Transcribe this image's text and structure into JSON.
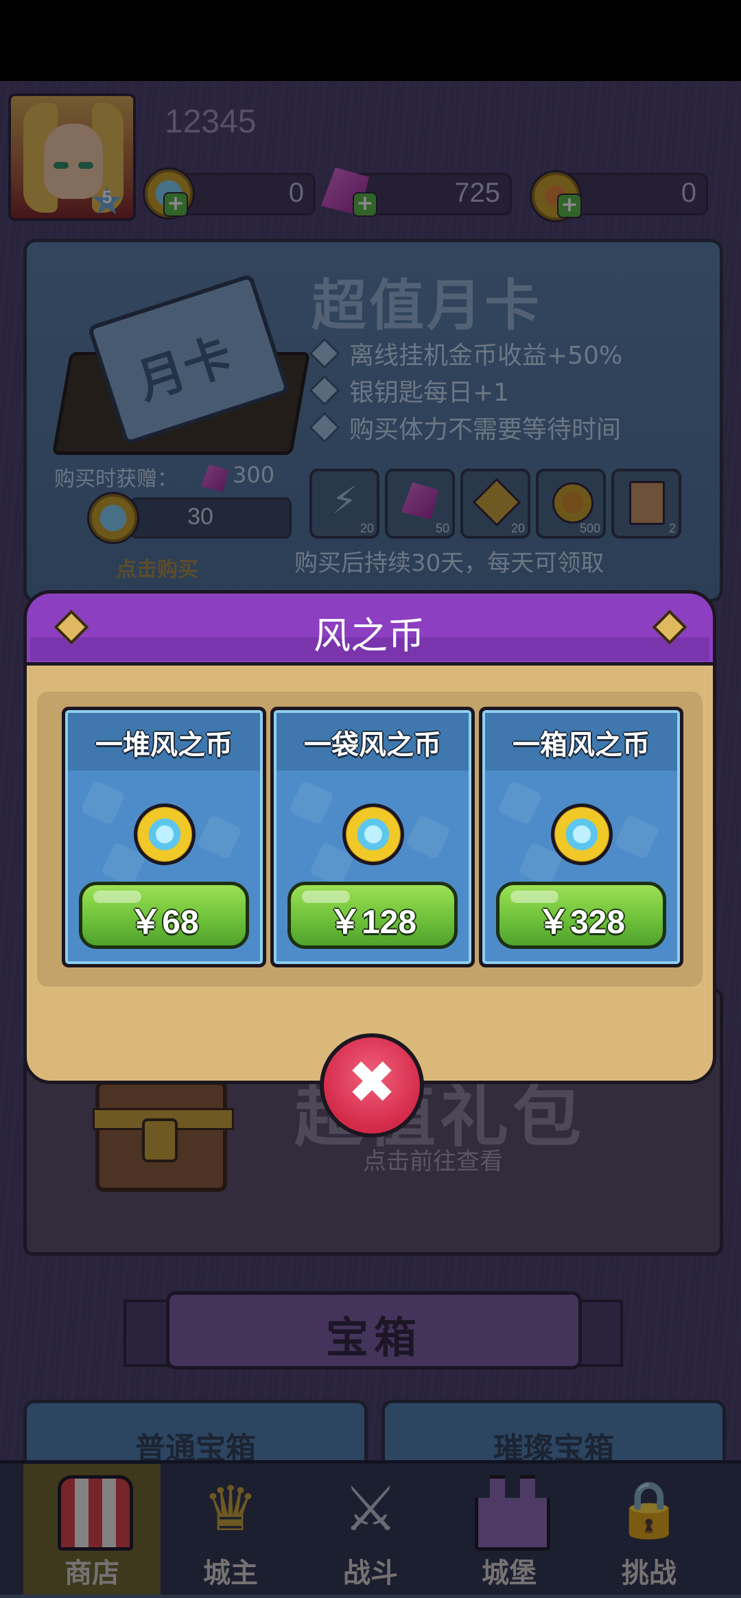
{
  "header": {
    "player_id": "12345",
    "level": "5",
    "resources": [
      {
        "name": "wind-coin",
        "value": "0"
      },
      {
        "name": "gem",
        "value": "725"
      },
      {
        "name": "medal",
        "value": "0"
      }
    ]
  },
  "month_card": {
    "title": "超值月卡",
    "card_text": "月卡",
    "benefits": [
      "离线挂机金币收益+50%",
      "银钥匙每日+1",
      "购买体力不需要等待时间"
    ],
    "gift_label": "购买时获赠：",
    "gift_value": "300",
    "price": "30",
    "buy_hint": "点击购买",
    "rewards": [
      {
        "icon": "energy-icon",
        "count": "20"
      },
      {
        "icon": "gem-icon",
        "count": "50"
      },
      {
        "icon": "puzzle-icon",
        "count": "20"
      },
      {
        "icon": "gold-coin-icon",
        "count": "500"
      },
      {
        "icon": "scroll-icon",
        "count": "2"
      }
    ],
    "footer": "购买后持续30天，每天可领取"
  },
  "gift_pack": {
    "title": "超值礼包",
    "subtitle": "点击前往查看"
  },
  "chest_section": {
    "title": "宝箱",
    "tabs": [
      "普通宝箱",
      "璀璨宝箱"
    ]
  },
  "modal": {
    "title": "风之币",
    "offers": [
      {
        "name": "一堆风之币",
        "price": "￥68"
      },
      {
        "name": "一袋风之币",
        "price": "￥128"
      },
      {
        "name": "一箱风之币",
        "price": "￥328"
      }
    ],
    "close_symbol": "✖"
  },
  "nav": {
    "items": [
      {
        "label": "商店",
        "active": true
      },
      {
        "label": "城主",
        "active": false
      },
      {
        "label": "战斗",
        "active": false
      },
      {
        "label": "城堡",
        "active": false
      },
      {
        "label": "挑战",
        "active": false
      }
    ]
  },
  "colors": {
    "modal_header": "#8c3fc1",
    "modal_body": "#d9b87a",
    "offer_card": "#4d8cc8",
    "buy_button": "#6fc23a",
    "close_button": "#d42a4a"
  }
}
